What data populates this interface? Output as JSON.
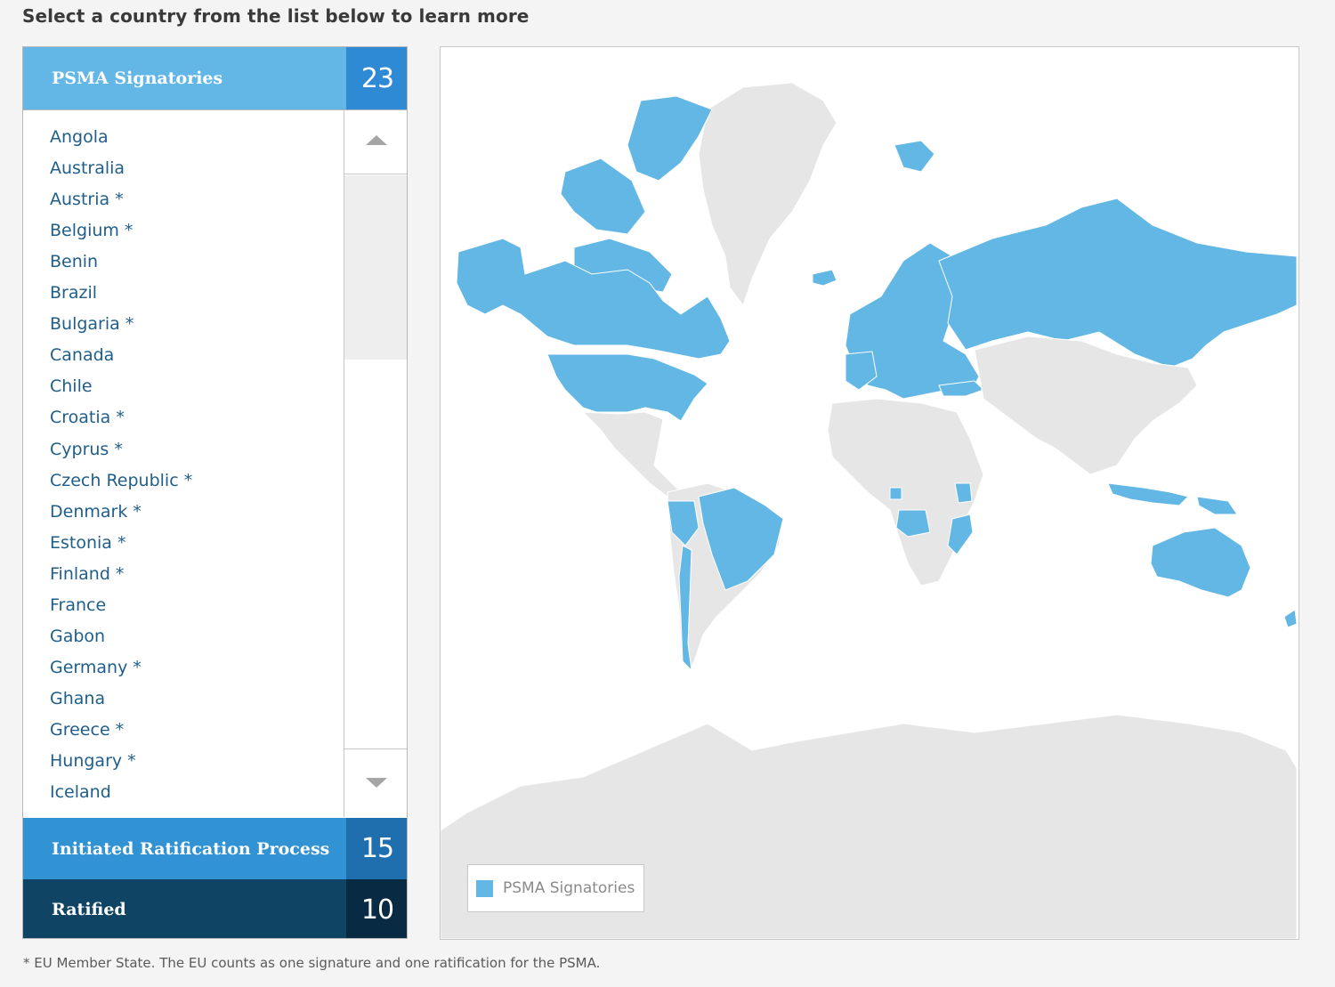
{
  "page": {
    "heading": "Select a country from the list below to learn more",
    "footnote": "* EU Member State. The EU counts as one signature and one ratification for the PSMA."
  },
  "categories": [
    {
      "label": "PSMA Signatories",
      "count": "23"
    },
    {
      "label": "Initiated Ratification Process",
      "count": "15"
    },
    {
      "label": "Ratified",
      "count": "10"
    }
  ],
  "country_list": [
    "Angola",
    "Australia",
    "Austria *",
    "Belgium *",
    "Benin",
    "Brazil",
    "Bulgaria *",
    "Canada",
    "Chile",
    "Croatia *",
    "Cyprus *",
    "Czech Republic *",
    "Denmark *",
    "Estonia *",
    "Finland *",
    "France",
    "Gabon",
    "Germany *",
    "Ghana",
    "Greece *",
    "Hungary *",
    "Iceland"
  ],
  "list_scroll": {
    "thumb_icon": "scroll-thumb",
    "up_icon": "triangle-up-icon",
    "down_icon": "triangle-down-icon"
  },
  "map": {
    "legend_label": "PSMA Signatories",
    "colors": {
      "highlight": "#62b7e5",
      "land": "#e6e6e6",
      "ocean": "#ffffff",
      "border": "#ffffff"
    },
    "highlighted_regions": [
      "North America (Canada, USA)",
      "Greenland is not highlighted",
      "Iceland",
      "Europe",
      "Russia",
      "Turkey",
      "Brazil",
      "Peru",
      "Chile",
      "Uruguay",
      "Angola",
      "Gabon",
      "Mozambique",
      "Kenya",
      "Australia",
      "Indonesia",
      "Papua New Guinea",
      "New Zealand"
    ]
  }
}
